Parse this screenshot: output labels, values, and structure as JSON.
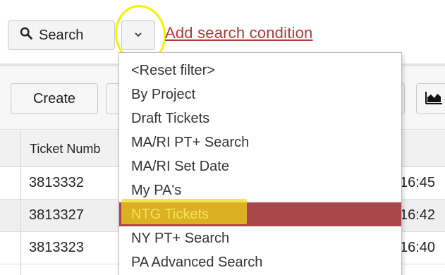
{
  "search": {
    "button_label": "Search",
    "button_icon": "search-icon",
    "toggle_icon": "chevron-down-icon",
    "add_condition_label": "Add search condition"
  },
  "toolbar": {
    "create_label": "Create",
    "chart_icon": "area-chart-icon"
  },
  "grid": {
    "header": "Ticket Numb",
    "rows": [
      {
        "ticket": "3813332",
        "time": "16:45"
      },
      {
        "ticket": "3813327",
        "time": "16:42"
      },
      {
        "ticket": "3813323",
        "time": "16:40"
      }
    ]
  },
  "menu": {
    "items": [
      "<Reset filter>",
      "By Project",
      "Draft Tickets",
      "MA/RI PT+ Search",
      "MA/RI Set Date",
      "My PA's",
      "NTG Tickets",
      "NY PT+ Search",
      "PA Advanced Search"
    ],
    "selected": "NTG Tickets"
  },
  "colors": {
    "link": "#b03a3a",
    "selected_bg": "#a8484c",
    "annotation_yellow": "#f7f200"
  }
}
